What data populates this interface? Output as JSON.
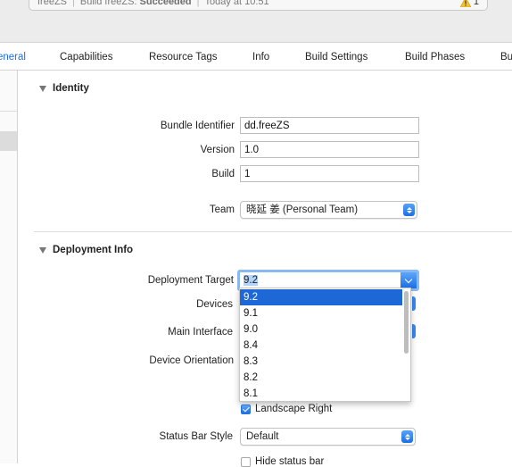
{
  "status_bar": {
    "project": "freeZS",
    "build_prefix": "Build freeZS:",
    "build_result": "Succeeded",
    "time": "Today at 10:51",
    "warning_count": "1"
  },
  "tabs": [
    {
      "label": "eneral"
    },
    {
      "label": "Capabilities"
    },
    {
      "label": "Resource Tags"
    },
    {
      "label": "Info"
    },
    {
      "label": "Build Settings"
    },
    {
      "label": "Build Phases"
    },
    {
      "label": "Bu"
    }
  ],
  "identity": {
    "header": "Identity",
    "bundle_identifier": {
      "label": "Bundle Identifier",
      "value": "dd.freeZS"
    },
    "version": {
      "label": "Version",
      "value": "1.0"
    },
    "build": {
      "label": "Build",
      "value": "1"
    },
    "team": {
      "label": "Team",
      "value": "晓延 姜 (Personal Team)"
    }
  },
  "deployment": {
    "header": "Deployment Info",
    "target": {
      "label": "Deployment Target",
      "value": "9.2"
    },
    "devices_label": "Devices",
    "main_interface_label": "Main Interface",
    "orientation_label": "Device Orientation",
    "options": [
      "9.2",
      "9.1",
      "9.0",
      "8.4",
      "8.3",
      "8.2",
      "8.1"
    ],
    "landscape_right": {
      "label": "Landscape Right",
      "checked": true
    },
    "status_bar_style": {
      "label": "Status Bar Style",
      "value": "Default"
    },
    "hide_status_bar": {
      "label": "Hide status bar",
      "checked": false
    }
  },
  "colors": {
    "accent": "#1d6ee8",
    "selection": "#1d67d6"
  }
}
